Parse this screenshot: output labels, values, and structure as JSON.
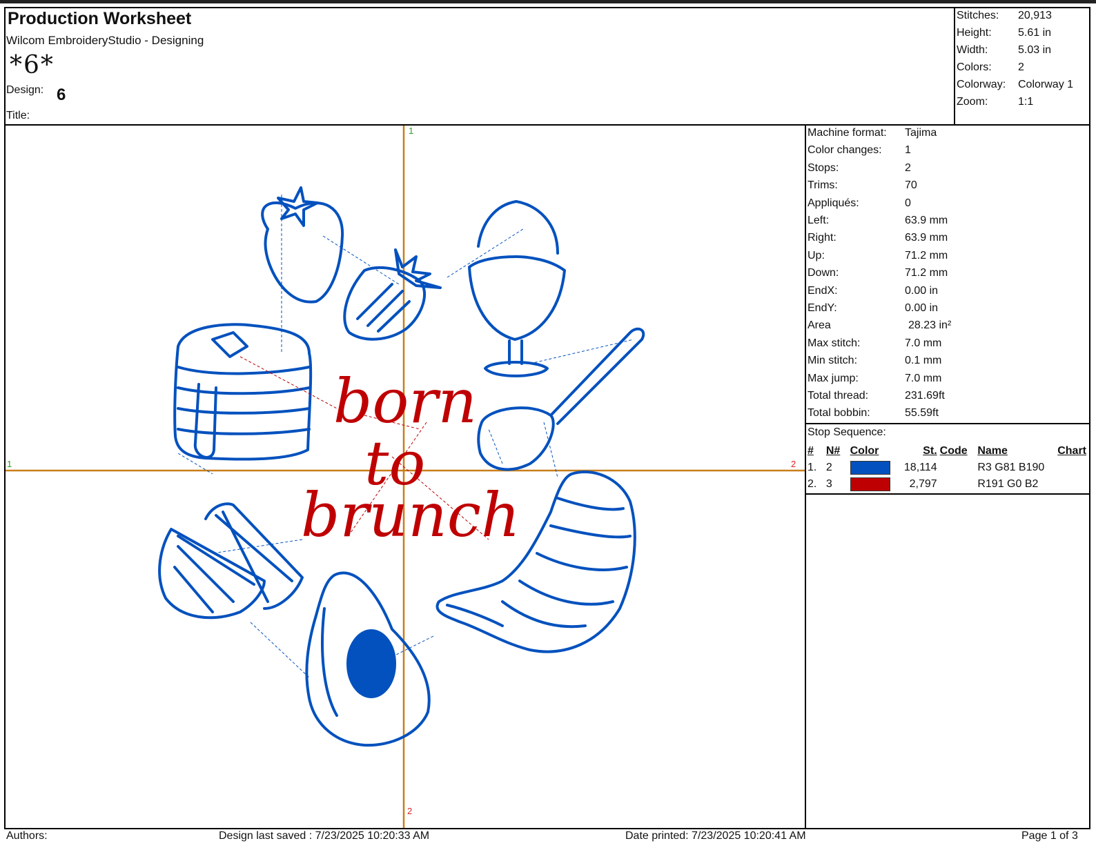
{
  "header": {
    "title": "Production Worksheet",
    "app": "Wilcom EmbroideryStudio - Designing",
    "signature": "*6*",
    "design_label": "Design:",
    "design_value": "6",
    "title_label": "Title:"
  },
  "top_stats": [
    {
      "label": "Stitches:",
      "value": "20,913"
    },
    {
      "label": "Height:",
      "value": "5.61 in"
    },
    {
      "label": "Width:",
      "value": "5.03 in"
    },
    {
      "label": "Colors:",
      "value": "2"
    },
    {
      "label": "Colorway:",
      "value": "Colorway 1"
    },
    {
      "label": "Zoom:",
      "value": "1:1"
    }
  ],
  "side_stats": [
    {
      "label": "Machine format:",
      "value": "Tajima"
    },
    {
      "label": "Color changes:",
      "value": "1"
    },
    {
      "label": "Stops:",
      "value": "2"
    },
    {
      "label": "Trims:",
      "value": "70"
    },
    {
      "label": "Appliqués:",
      "value": "0"
    },
    {
      "label": "Left:",
      "value": "63.9 mm"
    },
    {
      "label": "Right:",
      "value": "63.9 mm"
    },
    {
      "label": "Up:",
      "value": "71.2 mm"
    },
    {
      "label": "Down:",
      "value": "71.2 mm"
    },
    {
      "label": "EndX:",
      "value": "0.00 in"
    },
    {
      "label": "EndY:",
      "value": "0.00 in"
    },
    {
      "label": "Area",
      "value": "28.23 in²"
    },
    {
      "label": "Max stitch:",
      "value": "7.0 mm"
    },
    {
      "label": "Min stitch:",
      "value": "0.1 mm"
    },
    {
      "label": "Max jump:",
      "value": "7.0 mm"
    },
    {
      "label": "Total thread:",
      "value": "231.69ft"
    },
    {
      "label": "Total bobbin:",
      "value": "55.59ft"
    }
  ],
  "stop_sequence": {
    "title": "Stop Sequence:",
    "headers": [
      "#",
      "N#",
      "Color",
      "St.",
      "Code",
      "Name",
      "Chart"
    ],
    "rows": [
      {
        "index": "1.",
        "n": "2",
        "color": "#0351BE",
        "stitches": "18,114",
        "code": "",
        "name": "R3 G81 B190",
        "chart": ""
      },
      {
        "index": "2.",
        "n": "3",
        "color": "#BF0002",
        "stitches": "2,797",
        "code": "",
        "name": "R191 G0 B2",
        "chart": ""
      }
    ]
  },
  "design_preview": {
    "text_lines": [
      "born",
      "to",
      "brunch"
    ],
    "axis_labels": {
      "top": "1",
      "left": "1",
      "right": "2",
      "bottom": "2"
    },
    "colors": {
      "blue": "#0351BE",
      "red": "#BF0002",
      "axis": "#C87F1A"
    }
  },
  "footer": {
    "authors": "Authors:",
    "saved": "Design last saved : 7/23/2025 10:20:33 AM",
    "printed": "Date printed: 7/23/2025 10:20:41 AM",
    "page": "Page 1 of 3"
  }
}
